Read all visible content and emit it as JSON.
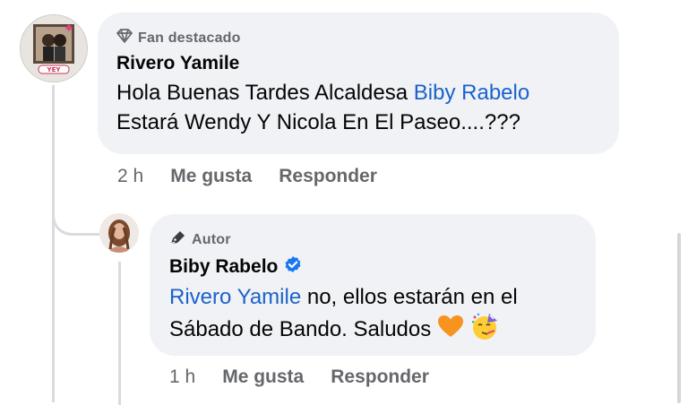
{
  "comment1": {
    "badge": "Fan destacado",
    "badge_icon": "diamond-icon",
    "author": "Rivero Yamile",
    "text_before": "Hola Buenas Tardes Alcaldesa ",
    "mention": "Biby Rabelo",
    "text_after": " Estará Wendy Y Nicola En El Paseo....???",
    "avatar_label": "YEY",
    "time": "2 h",
    "like": "Me gusta",
    "reply": "Responder"
  },
  "comment2": {
    "badge": "Autor",
    "badge_icon": "pen-icon",
    "author": "Biby Rabelo",
    "verified_icon": "verified-badge-icon",
    "mention": "Rivero Yamile",
    "text_after": " no, ellos estarán en el Sábado de Bando. Saludos",
    "emojis": [
      "orange-heart-icon",
      "party-face-icon"
    ],
    "time": "1 h",
    "like": "Me gusta",
    "reply": "Responder"
  },
  "colors": {
    "bubble": "#f0f2f5",
    "mention": "#1b62cc",
    "muted": "#65676b",
    "verified": "#1877f2",
    "heart": "#f7931e"
  }
}
